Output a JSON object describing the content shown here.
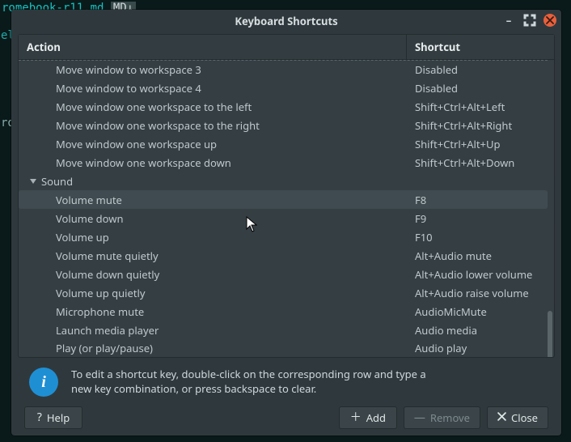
{
  "background": {
    "tab_filename": "romebook-r11.md",
    "marker_e": "el",
    "marker_r": "ro"
  },
  "window": {
    "title": "Keyboard Shortcuts"
  },
  "columns": {
    "action": "Action",
    "shortcut": "Shortcut"
  },
  "rows": [
    {
      "type": "item",
      "dashed": true,
      "action": "Move window to workspace 3",
      "shortcut": "Disabled"
    },
    {
      "type": "item",
      "action": "Move window to workspace 4",
      "shortcut": "Disabled"
    },
    {
      "type": "item",
      "action": "Move window one workspace to the left",
      "shortcut": "Shift+Ctrl+Alt+Left"
    },
    {
      "type": "item",
      "action": "Move window one workspace to the right",
      "shortcut": "Shift+Ctrl+Alt+Right"
    },
    {
      "type": "item",
      "action": "Move window one workspace up",
      "shortcut": "Shift+Ctrl+Alt+Up"
    },
    {
      "type": "item",
      "action": "Move window one workspace down",
      "shortcut": "Shift+Ctrl+Alt+Down"
    },
    {
      "type": "group",
      "action": "Sound",
      "shortcut": ""
    },
    {
      "type": "item",
      "selected": true,
      "action": "Volume mute",
      "shortcut": "F8"
    },
    {
      "type": "item",
      "action": "Volume down",
      "shortcut": "F9"
    },
    {
      "type": "item",
      "action": "Volume up",
      "shortcut": "F10"
    },
    {
      "type": "item",
      "action": "Volume mute quietly",
      "shortcut": "Alt+Audio mute"
    },
    {
      "type": "item",
      "action": "Volume down quietly",
      "shortcut": "Alt+Audio lower volume"
    },
    {
      "type": "item",
      "action": "Volume up quietly",
      "shortcut": "Alt+Audio raise volume"
    },
    {
      "type": "item",
      "action": "Microphone mute",
      "shortcut": "AudioMicMute"
    },
    {
      "type": "item",
      "action": "Launch media player",
      "shortcut": "Audio media"
    },
    {
      "type": "item",
      "dashedBottom": true,
      "action": "Play (or play/pause)",
      "shortcut": "Audio play"
    }
  ],
  "hint": {
    "line1": "To edit a shortcut key, double-click on the corresponding row and type a",
    "line2": "new key combination, or press backspace to clear."
  },
  "buttons": {
    "help": "Help",
    "add": "Add",
    "remove": "Remove",
    "close": "Close"
  }
}
